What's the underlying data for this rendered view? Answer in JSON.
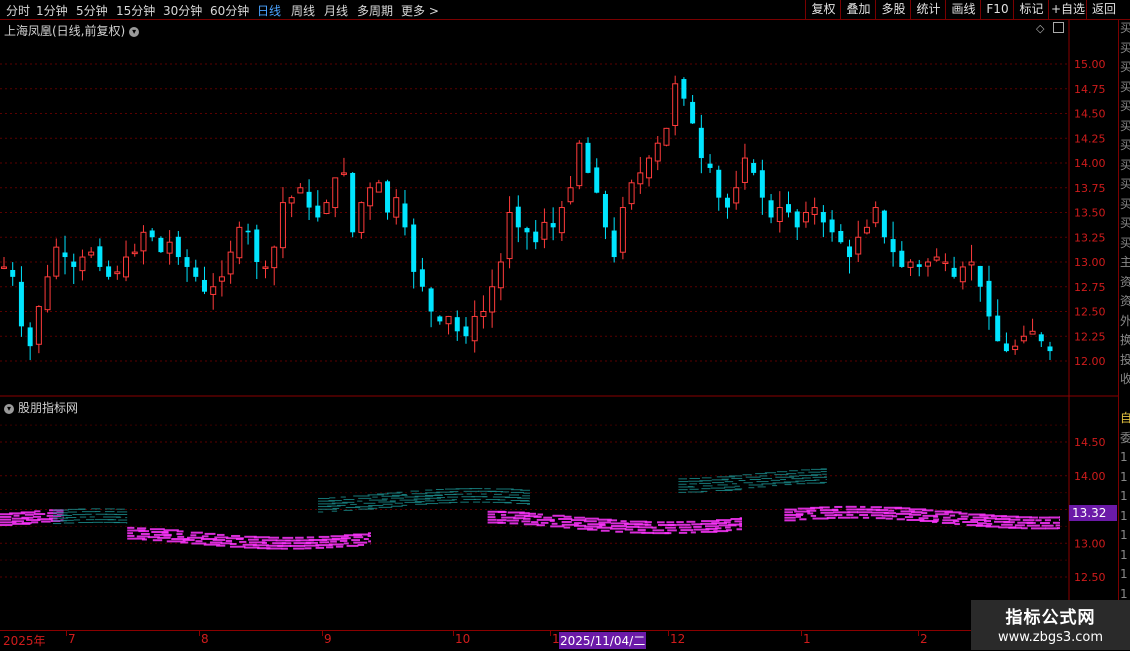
{
  "toolbar": {
    "periods": [
      "分时",
      "1分钟",
      "5分钟",
      "15分钟",
      "30分钟",
      "60分钟",
      "日线",
      "周线",
      "月线",
      "多周期",
      "更多 >"
    ],
    "active_index": 6,
    "right_buttons": [
      "复权",
      "叠加",
      "多股",
      "统计",
      "画线",
      "F10",
      "标记",
      "+自选",
      "返回"
    ]
  },
  "main_panel": {
    "title": "上海凤凰(日线,前复权)",
    "title_icon": "chevron-down-icon",
    "corner_icons": [
      "diamond-icon",
      "layout-icon"
    ],
    "y_axis": [
      "15.00",
      "14.75",
      "14.50",
      "14.25",
      "14.00",
      "13.75",
      "13.50",
      "13.25",
      "13.00",
      "12.75",
      "12.50",
      "12.25",
      "12.00"
    ]
  },
  "indicator_panel": {
    "title": "股朋指标网",
    "title_icon": "chevron-down-icon",
    "y_axis": [
      "14.50",
      "14.00",
      "13.50",
      "13.00",
      "12.50"
    ],
    "current_value": "13.32"
  },
  "sidebar_chars": [
    "买",
    "买",
    "买",
    "买",
    "买",
    "买",
    "买",
    "买",
    "买",
    "买",
    "买",
    "买",
    "主",
    "资",
    "资",
    "外",
    "换",
    "投",
    "收",
    "",
    "自",
    "委",
    "1",
    "1",
    "1",
    "1",
    "1",
    "1",
    "1",
    "1"
  ],
  "date_axis": [
    {
      "label": "2025年",
      "selected": false
    },
    {
      "label": "7",
      "selected": false
    },
    {
      "label": "8",
      "selected": false
    },
    {
      "label": "9",
      "selected": false
    },
    {
      "label": "10",
      "selected": false
    },
    {
      "label": "1",
      "selected": false
    },
    {
      "label": "2025/11/04/二",
      "selected": true
    },
    {
      "label": "12",
      "selected": false
    },
    {
      "label": "1",
      "selected": false
    },
    {
      "label": "2",
      "selected": false
    }
  ],
  "watermark": {
    "line1": "指标公式网",
    "line2": "www.zbgs3.com"
  },
  "colors": {
    "up": "#ff3b3b",
    "down": "#00e5ff",
    "grid": "#5a0000",
    "magenta": "#ff35ff",
    "teal": "#1a8c8c",
    "select": "#6b1aa8"
  },
  "chart_data": [
    {
      "type": "candlestick",
      "title": "上海凤凰(日线,前复权)",
      "ylim": [
        11.7,
        15.3
      ],
      "ticks": [
        15.0,
        14.75,
        14.5,
        14.25,
        14.0,
        13.75,
        13.5,
        13.25,
        13.0,
        12.75,
        12.5,
        12.25,
        12.0
      ],
      "x_labels": [
        "2025年",
        "7",
        "8",
        "9",
        "10",
        "1",
        "2025/11/04/二",
        "12",
        "1",
        "2"
      ],
      "series_ohlc_close": [
        12.95,
        12.85,
        12.35,
        12.15,
        12.55,
        12.85,
        13.15,
        13.05,
        12.95,
        13.05,
        13.1,
        12.95,
        12.85,
        12.9,
        13.05,
        13.1,
        13.3,
        13.25,
        13.1,
        13.2,
        13.05,
        12.95,
        12.85,
        12.7,
        12.75,
        12.85,
        13.1,
        13.35,
        13.3,
        13.0,
        12.95,
        13.15,
        13.6,
        13.65,
        13.75,
        13.55,
        13.45,
        13.6,
        13.85,
        13.9,
        13.3,
        13.6,
        13.75,
        13.8,
        13.5,
        13.65,
        13.35,
        12.9,
        12.75,
        12.5,
        12.4,
        12.45,
        12.3,
        12.25,
        12.45,
        12.5,
        12.75,
        13.0,
        13.5,
        13.35,
        13.3,
        13.2,
        13.4,
        13.35,
        13.55,
        13.75,
        14.2,
        13.9,
        13.7,
        13.35,
        13.05,
        13.55,
        13.8,
        13.9,
        14.05,
        14.2,
        14.35,
        14.8,
        14.65,
        14.4,
        14.05,
        13.95,
        13.65,
        13.55,
        13.75,
        14.05,
        13.9,
        13.65,
        13.45,
        13.55,
        13.5,
        13.35,
        13.5,
        13.55,
        13.4,
        13.3,
        13.2,
        13.05,
        13.25,
        13.35,
        13.55,
        13.25,
        13.1,
        12.95,
        13.0,
        12.95,
        13.0,
        13.05,
        13.0,
        12.85,
        12.95,
        13.0,
        12.75,
        12.45,
        12.2,
        12.1,
        12.15,
        12.25,
        12.3,
        12.2,
        12.1
      ]
    },
    {
      "type": "heatmap",
      "title": "股朋指标网",
      "ylim": [
        12.3,
        14.95
      ],
      "ticks": [
        14.5,
        14.0,
        13.5,
        13.0,
        12.5
      ],
      "current_value": 13.32,
      "segments": [
        {
          "x": [
            0,
            0.06
          ],
          "y": 13.37,
          "kind": "magenta"
        },
        {
          "x": [
            0.05,
            0.12
          ],
          "y": 13.35,
          "kind": "teal"
        },
        {
          "x": [
            0.12,
            0.35
          ],
          "y": 13.1,
          "kind": "magenta"
        },
        {
          "x": [
            0.3,
            0.5
          ],
          "y": 13.65,
          "kind": "teal"
        },
        {
          "x": [
            0.46,
            0.7
          ],
          "y": 13.33,
          "kind": "magenta"
        },
        {
          "x": [
            0.64,
            0.78
          ],
          "y": 13.95,
          "kind": "teal"
        },
        {
          "x": [
            0.74,
            1.0
          ],
          "y": 13.4,
          "kind": "magenta"
        }
      ]
    }
  ]
}
